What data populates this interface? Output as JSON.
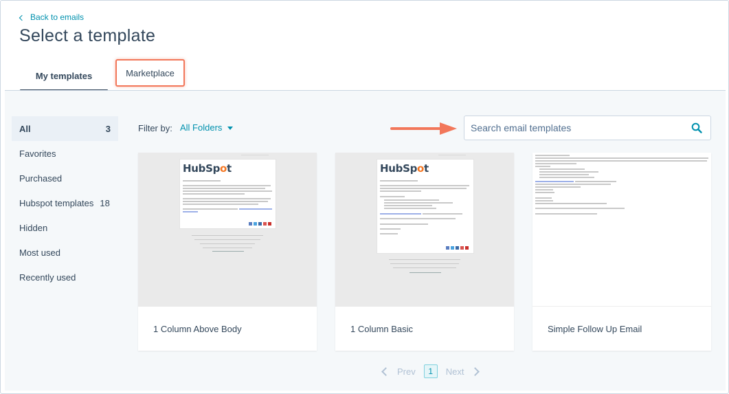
{
  "header": {
    "back_label": "Back to emails",
    "title": "Select a template",
    "tabs": [
      {
        "label": "My templates",
        "active": true
      },
      {
        "label": "Marketplace",
        "highlighted": true
      }
    ]
  },
  "sidebar": {
    "items": [
      {
        "label": "All",
        "count": "3",
        "active": true
      },
      {
        "label": "Favorites"
      },
      {
        "label": "Purchased"
      },
      {
        "label": "Hubspot templates",
        "count": "18"
      },
      {
        "label": "Hidden"
      },
      {
        "label": "Most used"
      },
      {
        "label": "Recently used"
      }
    ]
  },
  "filter": {
    "label": "Filter by:",
    "value": "All Folders"
  },
  "search": {
    "placeholder": "Search email templates",
    "value": ""
  },
  "cards": [
    {
      "label": "1 Column Above Body"
    },
    {
      "label": "1 Column Basic"
    },
    {
      "label": "Simple Follow Up Email"
    }
  ],
  "thumb": {
    "logo_hub": "HubSp",
    "logo_spot": "o",
    "logo_t": "t"
  },
  "pagination": {
    "prev": "Prev",
    "current": "1",
    "next": "Next"
  },
  "colors": {
    "accent": "#0091ae",
    "highlight": "#f2775a",
    "text": "#33475b"
  }
}
